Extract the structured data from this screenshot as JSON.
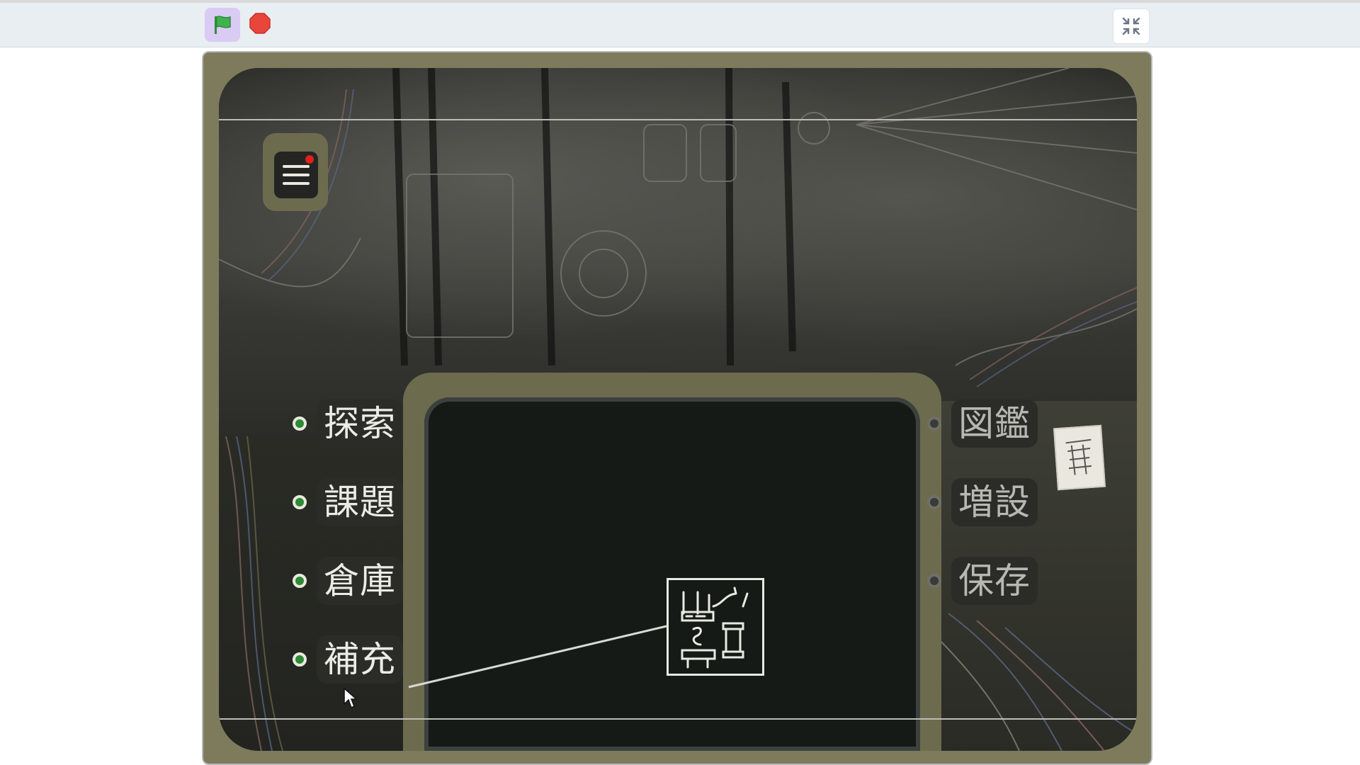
{
  "toolbar": {
    "green_flag_icon": "green-flag-icon",
    "stop_icon": "stop-sign-icon",
    "fullscreen_icon": "exit-fullscreen-icon",
    "colors": {
      "flag": "#3fb24b",
      "stop": "#e8453c",
      "flag_bg": "#d9cbf3"
    }
  },
  "game": {
    "menu_icon": "hamburger-menu-icon",
    "notification_color": "#e0201a",
    "left_menu": [
      {
        "label": "探索",
        "active": true
      },
      {
        "label": "課題",
        "active": true
      },
      {
        "label": "倉庫",
        "active": true
      },
      {
        "label": "補充",
        "active": true
      }
    ],
    "right_menu": [
      {
        "label": "図鑑",
        "active": false
      },
      {
        "label": "増設",
        "active": false
      },
      {
        "label": "保存",
        "active": false
      }
    ],
    "selected_item_icon": "supply-schematic-icon",
    "colors": {
      "frame": "#7d7b5c",
      "screen": "#151a16",
      "radio_on": "#2d8a36"
    }
  }
}
